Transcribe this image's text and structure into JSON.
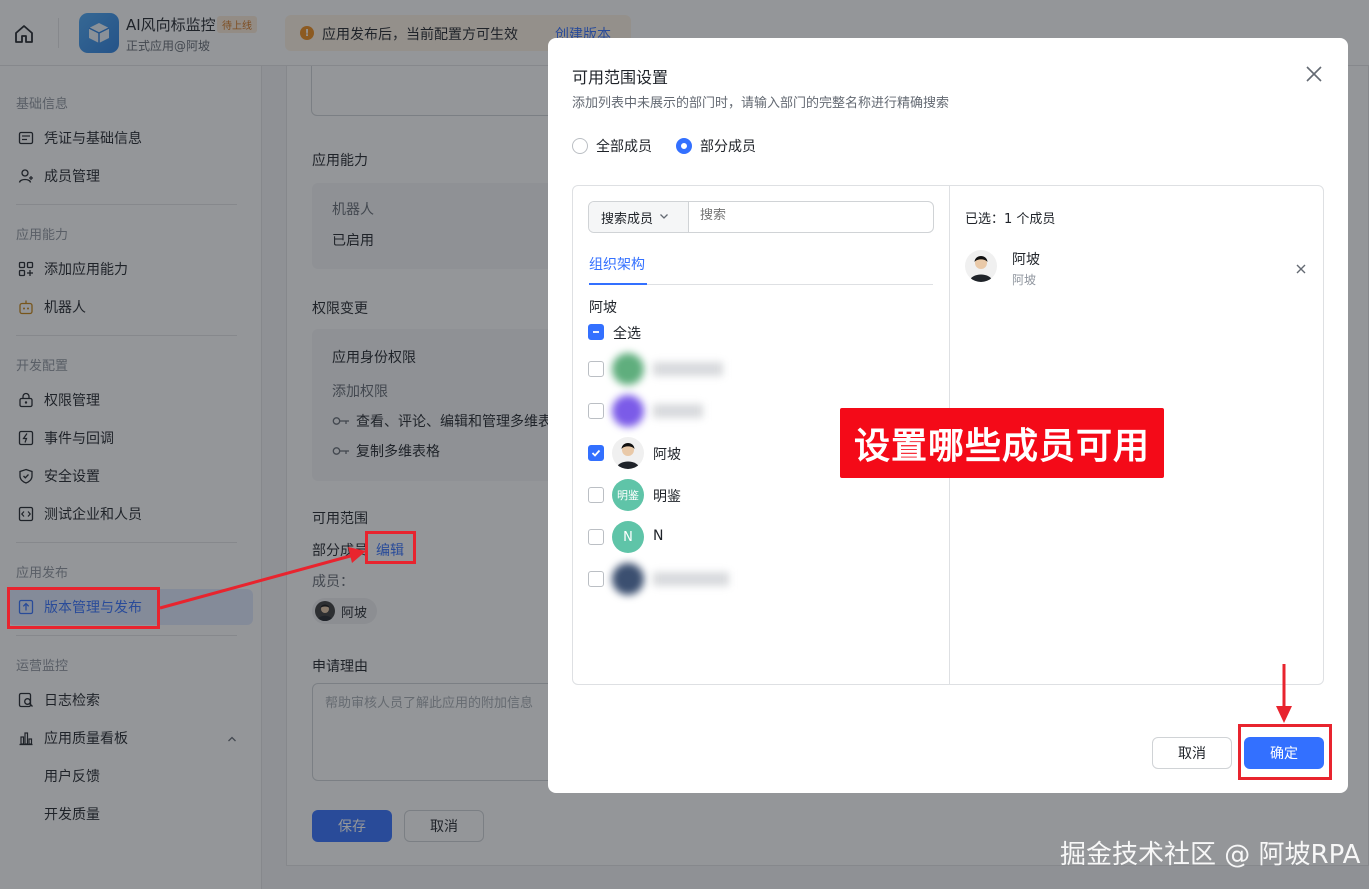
{
  "header": {
    "app_name": "AI风向标监控",
    "status_tag": "待上线",
    "app_sub": "正式应用@阿坡",
    "notice_text": "应用发布后，当前配置方可生效",
    "notice_link": "创建版本"
  },
  "sidebar": {
    "groups": {
      "basic": "基础信息",
      "ability": "应用能力",
      "dev": "开发配置",
      "publish": "应用发布",
      "ops": "运营监控"
    },
    "items": {
      "credentials": "凭证与基础信息",
      "members": "成员管理",
      "add_ability": "添加应用能力",
      "bot": "机器人",
      "permission": "权限管理",
      "events": "事件与回调",
      "security": "安全设置",
      "test_org": "测试企业和人员",
      "version": "版本管理与发布",
      "logs": "日志检索",
      "quality": "应用质量看板",
      "feedback": "用户反馈",
      "dev_quality": "开发质量"
    }
  },
  "main": {
    "ability_title": "应用能力",
    "bot_label": "机器人",
    "bot_status": "已启用",
    "perm_title": "权限变更",
    "identity_perm": "应用身份权限",
    "add_perm": "添加权限",
    "perm1": "查看、评论、编辑和管理多维表格",
    "perm2": "复制多维表格",
    "scope_title": "可用范围",
    "scope_value": "部分成员",
    "scope_edit": "编辑",
    "members_label": "成员：",
    "member_chip": "阿坡",
    "reason_title": "申请理由",
    "reason_placeholder": "帮助审核人员了解此应用的附加信息",
    "save": "保存",
    "cancel": "取消"
  },
  "modal": {
    "title": "可用范围设置",
    "desc": "添加列表中未展示的部门时，请输入部门的完整名称进行精确搜索",
    "radio_all": "全部成员",
    "radio_partial": "部分成员",
    "search_type": "搜索成员",
    "search_placeholder": "搜索",
    "tab_org": "组织架构",
    "org_name": "阿坡",
    "select_all": "全选",
    "members": [
      {
        "name": "",
        "checked": false,
        "avatar_color": "#5fae7d"
      },
      {
        "name": "",
        "checked": false,
        "avatar_color": "#7b5be8"
      },
      {
        "name": "阿坡",
        "checked": true,
        "avatar_color": "#3a3a3a"
      },
      {
        "name": "明鉴",
        "avatar_text": "明鉴",
        "checked": false,
        "avatar_color": "#5fc4a8"
      },
      {
        "name": "N",
        "avatar_text": "N",
        "checked": false,
        "avatar_color": "#5fc4a8"
      },
      {
        "name": "",
        "checked": false,
        "avatar_color": "#3b4f70"
      }
    ],
    "selected_count": "已选：1 个成员",
    "selected": [
      {
        "name": "阿坡",
        "sub": "阿坡"
      }
    ],
    "cancel": "取消",
    "confirm": "确定"
  },
  "annotation": {
    "callout": "设置哪些成员可用",
    "callout_color": "#f40a18"
  },
  "watermark": "掘金技术社区 @ 阿坡RPA"
}
